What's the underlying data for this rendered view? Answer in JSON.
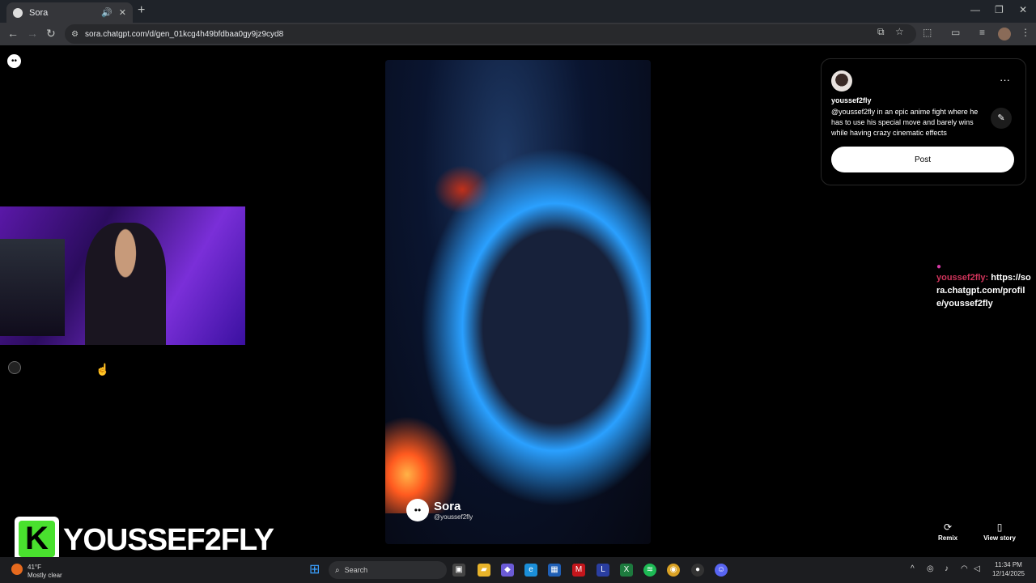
{
  "browser": {
    "tab_title": "Sora",
    "url": "sora.chatgpt.com/d/gen_01kcg4h49bfdbaa0gy9jz9cyd8",
    "new_tab": "+",
    "icons": {
      "back": "arrow-left",
      "forward": "arrow-right",
      "reload": "refresh",
      "site_info": "tune"
    }
  },
  "post": {
    "username": "youssef2fly",
    "prompt": "@youssef2fly in an epic anime fight where he has to use his special move and barely wins while having crazy cinematic effects",
    "post_label": "Post"
  },
  "video": {
    "watermark_name": "Sora",
    "watermark_handle": "@youssef2fly"
  },
  "chat": {
    "user": "youssef2fly:",
    "message": "https://sora.chatgpt.com/profile/youssef2fly"
  },
  "actions": {
    "remix_label": "Remix",
    "view_story_label": "View story"
  },
  "overlay": {
    "badge_letter": "K",
    "streamer_name": "YOUSSEF2FLY"
  },
  "taskbar": {
    "weather_temp": "41°F",
    "weather_text": "Mostly clear",
    "search_placeholder": "Search",
    "time": "11:34 PM",
    "date": "12/14/2025"
  }
}
